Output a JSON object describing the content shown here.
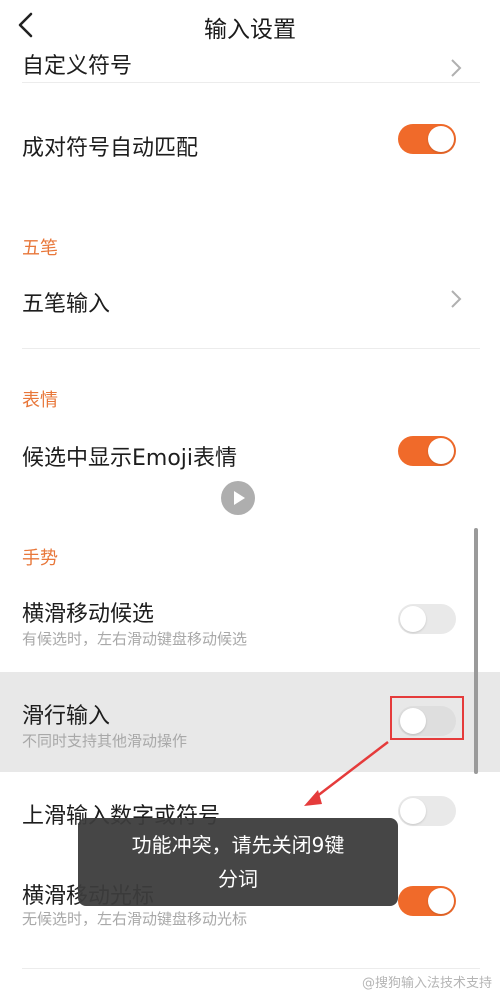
{
  "header": {
    "title": "输入设置"
  },
  "items": {
    "custom_symbols": "自定义符号",
    "pair_match": "成对符号自动匹配",
    "wubi_section": "五笔",
    "wubi_input": "五笔输入",
    "emoji_section": "表情",
    "emoji_candidates": "候选中显示Emoji表情",
    "gesture_section": "手势",
    "swipe_candidates": "横滑移动候选",
    "swipe_candidates_desc": "有候选时，左右滑动键盘移动候选",
    "glide_input": "滑行输入",
    "glide_input_desc": "不同时支持其他滑动操作",
    "swipe_up": "上滑输入数字或符号",
    "swipe_cursor": "横滑移动光标",
    "swipe_cursor_desc": "无候选时，左右滑动键盘移动光标"
  },
  "toast": {
    "line1": "功能冲突，请先关闭9键",
    "line2": "分词"
  },
  "watermark": "@搜狗输入法技术支持",
  "colors": {
    "accent": "#f06a2a",
    "section": "#e8773a",
    "annotation": "#e53b3b"
  }
}
